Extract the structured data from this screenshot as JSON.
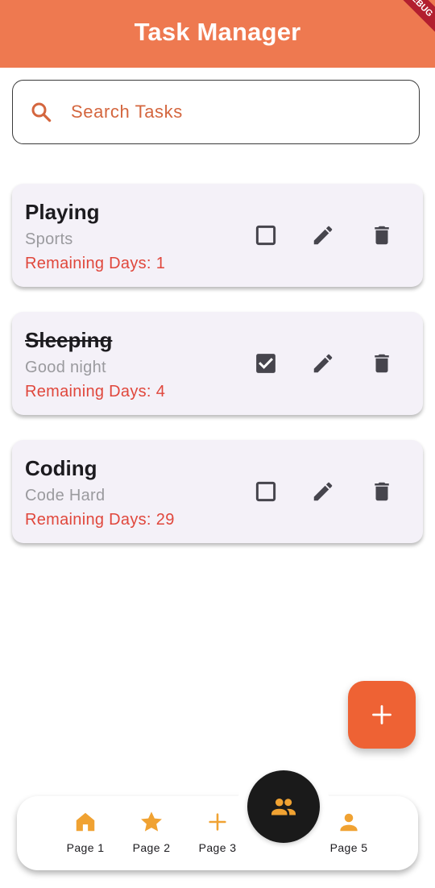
{
  "app": {
    "title": "Task Manager",
    "debug_banner": "DEBUG",
    "colors": {
      "appbar": "#ee7950",
      "accent": "#d4663e",
      "remaining": "#e0473c",
      "fab": "#ee6234",
      "nav_icon": "#f0a232"
    }
  },
  "search": {
    "placeholder": "Search Tasks",
    "value": "",
    "icon": "search-icon"
  },
  "tasks": [
    {
      "title": "Playing",
      "subtitle": "Sports",
      "remaining_label": "Remaining Days:",
      "remaining_days": "1",
      "completed": false
    },
    {
      "title": "Sleeping",
      "subtitle": "Good night",
      "remaining_label": "Remaining Days:",
      "remaining_days": "4",
      "completed": true
    },
    {
      "title": "Coding",
      "subtitle": "Code Hard",
      "remaining_label": "Remaining Days:",
      "remaining_days": "29",
      "completed": false
    }
  ],
  "fab": {
    "icon": "plus-icon"
  },
  "bottom_nav": {
    "items": [
      {
        "label": "Page 1",
        "icon": "home-icon"
      },
      {
        "label": "Page 2",
        "icon": "star-icon"
      },
      {
        "label": "Page 3",
        "icon": "plus-icon"
      },
      {
        "label": "Page 5",
        "icon": "person-icon"
      }
    ],
    "center": {
      "icon": "people-icon"
    }
  }
}
